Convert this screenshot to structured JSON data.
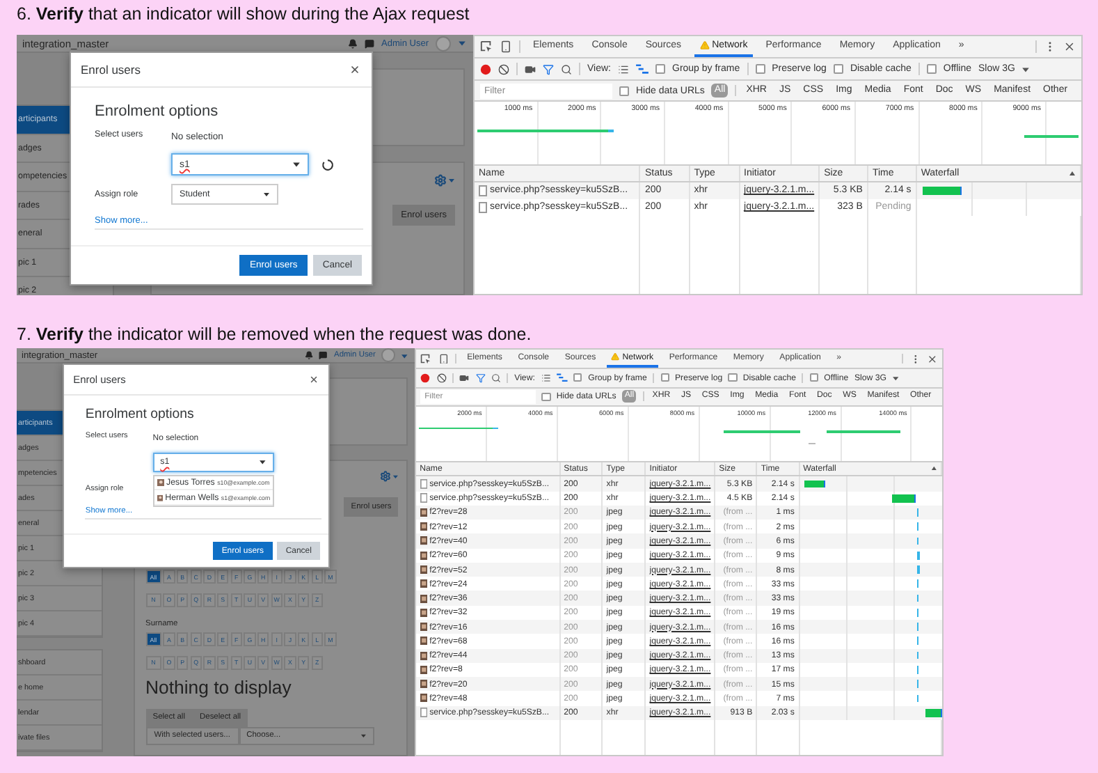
{
  "steps": [
    {
      "caption": "6. **Verify** that an indicator will show during the Ajax request",
      "moodle": {
        "site_name": "integration_master",
        "user": "Admin User",
        "sidebar": [
          {
            "items": [
              {
                "label": "articipants",
                "selected": true
              },
              {
                "label": "adges",
                "selected": false
              },
              {
                "label": "ompetencies",
                "selected": false
              },
              {
                "label": "rades",
                "selected": false
              },
              {
                "label": "eneral",
                "selected": false
              },
              {
                "label": "pic 1",
                "selected": false
              },
              {
                "label": "pic 2",
                "selected": false
              }
            ]
          }
        ],
        "enrol_button": "Enrol users",
        "modal": {
          "title": "Enrol users",
          "heading": "Enrolment options",
          "select_label": "Select users",
          "selection": "No selection",
          "search_value": "s1",
          "loading": true,
          "role_label": "Assign role",
          "role_value": "Student",
          "show_more": "Show more...",
          "buttons": [
            {
              "label": "Enrol users",
              "kind": "primary"
            },
            {
              "label": "Cancel",
              "kind": "secondary"
            }
          ]
        }
      },
      "devtools": {
        "tabs": [
          {
            "label": "Elements",
            "selected": false,
            "warning": false
          },
          {
            "label": "Console",
            "selected": false,
            "warning": false
          },
          {
            "label": "Sources",
            "selected": false,
            "warning": false
          },
          {
            "label": "Network",
            "selected": true,
            "warning": true
          },
          {
            "label": "Performance",
            "selected": false,
            "warning": false
          },
          {
            "label": "Memory",
            "selected": false,
            "warning": false
          },
          {
            "label": "Application",
            "selected": false,
            "warning": false
          }
        ],
        "more_tabs": "»",
        "toolbar": {
          "view_label": "View:",
          "checkboxes": [
            {
              "label": "Group by frame",
              "checked": false
            },
            {
              "label": "Preserve log",
              "checked": false
            },
            {
              "label": "Disable cache",
              "checked": false
            },
            {
              "label": "Offline",
              "checked": false
            }
          ],
          "throttle": "Slow 3G"
        },
        "filter": {
          "placeholder": "Filter",
          "hide_data_urls": {
            "label": "Hide data URLs",
            "checked": false
          },
          "types": [
            {
              "label": "All",
              "selected": true
            },
            {
              "label": "XHR",
              "selected": false
            },
            {
              "label": "JS",
              "selected": false
            },
            {
              "label": "CSS",
              "selected": false
            },
            {
              "label": "Img",
              "selected": false
            },
            {
              "label": "Media",
              "selected": false
            },
            {
              "label": "Font",
              "selected": false
            },
            {
              "label": "Doc",
              "selected": false
            },
            {
              "label": "WS",
              "selected": false
            },
            {
              "label": "Manifest",
              "selected": false
            },
            {
              "label": "Other",
              "selected": false
            }
          ]
        },
        "overview_ticks": [
          "1000 ms",
          "2000 ms",
          "3000 ms",
          "4000 ms",
          "5000 ms",
          "6000 ms",
          "7000 ms",
          "8000 ms",
          "9000 ms"
        ],
        "columns": [
          "Name",
          "Status",
          "Type",
          "Initiator",
          "Size",
          "Time",
          "Waterfall"
        ],
        "rows": [
          {
            "kind": "xhr",
            "name": "service.php?sesskey=ku5SzB...",
            "status": "200",
            "type": "xhr",
            "initiator": "jquery-3.2.1.m...",
            "size": "5.3 KB",
            "time": "2.14 s",
            "pending": false
          },
          {
            "kind": "xhr",
            "name": "service.php?sesskey=ku5SzB...",
            "status": "200",
            "type": "xhr",
            "initiator": "jquery-3.2.1.m...",
            "size": "323 B",
            "time": "Pending",
            "pending": true
          }
        ]
      }
    },
    {
      "caption": "7. **Verify** the indicator will be removed when the request was done.",
      "moodle": {
        "site_name": "integration_master",
        "user": "Admin User",
        "sidebar": [
          {
            "items": [
              {
                "label": "articipants",
                "selected": true
              },
              {
                "label": "adges",
                "selected": false
              },
              {
                "label": "mpetencies",
                "selected": false
              },
              {
                "label": "ades",
                "selected": false
              },
              {
                "label": "eneral",
                "selected": false
              },
              {
                "label": "pic 1",
                "selected": false
              },
              {
                "label": "pic 2",
                "selected": false
              },
              {
                "label": "pic 3",
                "selected": false
              },
              {
                "label": "pic 4",
                "selected": false
              }
            ]
          },
          {
            "items": [
              {
                "label": "shboard",
                "selected": false
              },
              {
                "label": "e home",
                "selected": false
              },
              {
                "label": "lendar",
                "selected": false
              },
              {
                "label": "ivate files",
                "selected": false
              }
            ]
          }
        ],
        "enrol_button": "Enrol users",
        "initials_filters": [
          {
            "letters": [
              {
                "label": "All",
                "selected": true
              },
              {
                "label": "A",
                "selected": false
              },
              {
                "label": "B",
                "selected": false
              },
              {
                "label": "C",
                "selected": false
              },
              {
                "label": "D",
                "selected": false
              },
              {
                "label": "E",
                "selected": false
              },
              {
                "label": "F",
                "selected": false
              },
              {
                "label": "G",
                "selected": false
              },
              {
                "label": "H",
                "selected": false
              },
              {
                "label": "I",
                "selected": false
              },
              {
                "label": "J",
                "selected": false
              },
              {
                "label": "K",
                "selected": false
              },
              {
                "label": "L",
                "selected": false
              },
              {
                "label": "M",
                "selected": false
              },
              {
                "label": "N",
                "selected": false
              },
              {
                "label": "O",
                "selected": false
              },
              {
                "label": "P",
                "selected": false
              },
              {
                "label": "Q",
                "selected": false
              },
              {
                "label": "R",
                "selected": false
              },
              {
                "label": "S",
                "selected": false
              },
              {
                "label": "T",
                "selected": false
              },
              {
                "label": "U",
                "selected": false
              },
              {
                "label": "V",
                "selected": false
              },
              {
                "label": "W",
                "selected": false
              },
              {
                "label": "X",
                "selected": false
              },
              {
                "label": "Y",
                "selected": false
              },
              {
                "label": "Z",
                "selected": false
              }
            ]
          },
          {
            "label": "Surname",
            "letters": [
              {
                "label": "All",
                "selected": true
              },
              {
                "label": "A",
                "selected": false
              },
              {
                "label": "B",
                "selected": false
              },
              {
                "label": "C",
                "selected": false
              },
              {
                "label": "D",
                "selected": false
              },
              {
                "label": "E",
                "selected": false
              },
              {
                "label": "F",
                "selected": false
              },
              {
                "label": "G",
                "selected": false
              },
              {
                "label": "H",
                "selected": false
              },
              {
                "label": "I",
                "selected": false
              },
              {
                "label": "J",
                "selected": false
              },
              {
                "label": "K",
                "selected": false
              },
              {
                "label": "L",
                "selected": false
              },
              {
                "label": "M",
                "selected": false
              },
              {
                "label": "N",
                "selected": false
              },
              {
                "label": "O",
                "selected": false
              },
              {
                "label": "P",
                "selected": false
              },
              {
                "label": "Q",
                "selected": false
              },
              {
                "label": "R",
                "selected": false
              },
              {
                "label": "S",
                "selected": false
              },
              {
                "label": "T",
                "selected": false
              },
              {
                "label": "U",
                "selected": false
              },
              {
                "label": "V",
                "selected": false
              },
              {
                "label": "W",
                "selected": false
              },
              {
                "label": "X",
                "selected": false
              },
              {
                "label": "Y",
                "selected": false
              },
              {
                "label": "Z",
                "selected": false
              }
            ]
          }
        ],
        "empty_message": "Nothing to display",
        "bulk_buttons": [
          "Select all",
          "Deselect all"
        ],
        "with_selected_label": "With selected users...",
        "with_selected_value": "Choose...",
        "modal": {
          "title": "Enrol users",
          "heading": "Enrolment options",
          "select_label": "Select users",
          "selection": "No selection",
          "search_value": "s1",
          "loading": false,
          "suggestions": [
            {
              "name": "Jesus Torres",
              "email": "s10@example.com"
            },
            {
              "name": "Herman Wells",
              "email": "s1@example.com"
            }
          ],
          "role_label": "Assign role",
          "show_more": "Show more...",
          "buttons": [
            {
              "label": "Enrol users",
              "kind": "primary"
            },
            {
              "label": "Cancel",
              "kind": "secondary"
            }
          ]
        }
      },
      "devtools": {
        "tabs": [
          {
            "label": "Elements",
            "selected": false,
            "warning": false
          },
          {
            "label": "Console",
            "selected": false,
            "warning": false
          },
          {
            "label": "Sources",
            "selected": false,
            "warning": false
          },
          {
            "label": "Network",
            "selected": true,
            "warning": true
          },
          {
            "label": "Performance",
            "selected": false,
            "warning": false
          },
          {
            "label": "Memory",
            "selected": false,
            "warning": false
          },
          {
            "label": "Application",
            "selected": false,
            "warning": false
          }
        ],
        "more_tabs": "»",
        "toolbar": {
          "view_label": "View:",
          "checkboxes": [
            {
              "label": "Group by frame",
              "checked": false
            },
            {
              "label": "Preserve log",
              "checked": false
            },
            {
              "label": "Disable cache",
              "checked": false
            },
            {
              "label": "Offline",
              "checked": false
            }
          ],
          "throttle": "Slow 3G"
        },
        "filter": {
          "placeholder": "Filter",
          "hide_data_urls": {
            "label": "Hide data URLs",
            "checked": false
          },
          "types": [
            {
              "label": "All",
              "selected": true
            },
            {
              "label": "XHR",
              "selected": false
            },
            {
              "label": "JS",
              "selected": false
            },
            {
              "label": "CSS",
              "selected": false
            },
            {
              "label": "Img",
              "selected": false
            },
            {
              "label": "Media",
              "selected": false
            },
            {
              "label": "Font",
              "selected": false
            },
            {
              "label": "Doc",
              "selected": false
            },
            {
              "label": "WS",
              "selected": false
            },
            {
              "label": "Manifest",
              "selected": false
            },
            {
              "label": "Other",
              "selected": false
            }
          ]
        },
        "overview_ticks": [
          "2000 ms",
          "4000 ms",
          "6000 ms",
          "8000 ms",
          "10000 ms",
          "12000 ms",
          "14000 ms"
        ],
        "columns": [
          "Name",
          "Status",
          "Type",
          "Initiator",
          "Size",
          "Time",
          "Waterfall"
        ],
        "rows": [
          {
            "kind": "xhr",
            "name": "service.php?sesskey=ku5SzB...",
            "status": "200",
            "type": "xhr",
            "initiator": "jquery-3.2.1.m...",
            "size": "5.3 KB",
            "time": "2.14 s",
            "pending": false
          },
          {
            "kind": "xhr",
            "name": "service.php?sesskey=ku5SzB...",
            "status": "200",
            "type": "xhr",
            "initiator": "jquery-3.2.1.m...",
            "size": "4.5 KB",
            "time": "2.14 s",
            "pending": false
          },
          {
            "kind": "image",
            "name": "f2?rev=28",
            "status": "200",
            "type": "jpeg",
            "initiator": "jquery-3.2.1.m...",
            "size": "(from ...",
            "time": "1 ms",
            "pending": false
          },
          {
            "kind": "image",
            "name": "f2?rev=12",
            "status": "200",
            "type": "jpeg",
            "initiator": "jquery-3.2.1.m...",
            "size": "(from ...",
            "time": "2 ms",
            "pending": false
          },
          {
            "kind": "image",
            "name": "f2?rev=40",
            "status": "200",
            "type": "jpeg",
            "initiator": "jquery-3.2.1.m...",
            "size": "(from ...",
            "time": "6 ms",
            "pending": false
          },
          {
            "kind": "image",
            "name": "f2?rev=60",
            "status": "200",
            "type": "jpeg",
            "initiator": "jquery-3.2.1.m...",
            "size": "(from ...",
            "time": "9 ms",
            "pending": false
          },
          {
            "kind": "image",
            "name": "f2?rev=52",
            "status": "200",
            "type": "jpeg",
            "initiator": "jquery-3.2.1.m...",
            "size": "(from ...",
            "time": "8 ms",
            "pending": false
          },
          {
            "kind": "image",
            "name": "f2?rev=24",
            "status": "200",
            "type": "jpeg",
            "initiator": "jquery-3.2.1.m...",
            "size": "(from ...",
            "time": "33 ms",
            "pending": false
          },
          {
            "kind": "image",
            "name": "f2?rev=36",
            "status": "200",
            "type": "jpeg",
            "initiator": "jquery-3.2.1.m...",
            "size": "(from ...",
            "time": "33 ms",
            "pending": false
          },
          {
            "kind": "image",
            "name": "f2?rev=32",
            "status": "200",
            "type": "jpeg",
            "initiator": "jquery-3.2.1.m...",
            "size": "(from ...",
            "time": "19 ms",
            "pending": false
          },
          {
            "kind": "image",
            "name": "f2?rev=16",
            "status": "200",
            "type": "jpeg",
            "initiator": "jquery-3.2.1.m...",
            "size": "(from ...",
            "time": "16 ms",
            "pending": false
          },
          {
            "kind": "image",
            "name": "f2?rev=68",
            "status": "200",
            "type": "jpeg",
            "initiator": "jquery-3.2.1.m...",
            "size": "(from ...",
            "time": "16 ms",
            "pending": false
          },
          {
            "kind": "image",
            "name": "f2?rev=44",
            "status": "200",
            "type": "jpeg",
            "initiator": "jquery-3.2.1.m...",
            "size": "(from ...",
            "time": "13 ms",
            "pending": false
          },
          {
            "kind": "image",
            "name": "f2?rev=8",
            "status": "200",
            "type": "jpeg",
            "initiator": "jquery-3.2.1.m...",
            "size": "(from ...",
            "time": "17 ms",
            "pending": false
          },
          {
            "kind": "image",
            "name": "f2?rev=20",
            "status": "200",
            "type": "jpeg",
            "initiator": "jquery-3.2.1.m...",
            "size": "(from ...",
            "time": "15 ms",
            "pending": false
          },
          {
            "kind": "image",
            "name": "f2?rev=48",
            "status": "200",
            "type": "jpeg",
            "initiator": "jquery-3.2.1.m...",
            "size": "(from ...",
            "time": "7 ms",
            "pending": false
          },
          {
            "kind": "xhr",
            "name": "service.php?sesskey=ku5SzB...",
            "status": "200",
            "type": "xhr",
            "initiator": "jquery-3.2.1.m...",
            "size": "913 B",
            "time": "2.03 s",
            "pending": false
          }
        ]
      }
    }
  ]
}
